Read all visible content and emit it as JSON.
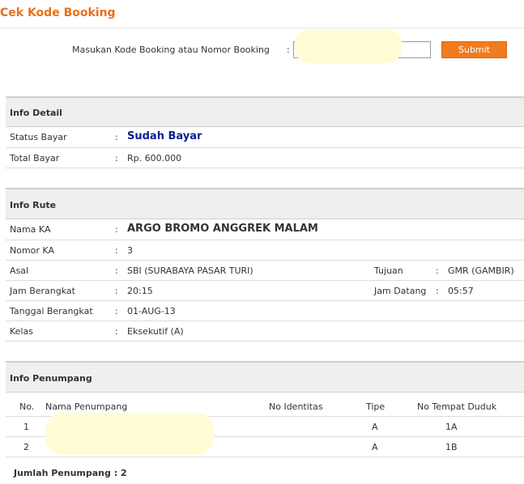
{
  "page": {
    "title": "Cek Kode Booking"
  },
  "search": {
    "label": "Masukan Kode Booking atau Nomor Booking",
    "colon": ":",
    "value": "",
    "submit_label": "Submit"
  },
  "info_detail": {
    "heading": "Info Detail",
    "rows": [
      {
        "label": "Status Bayar",
        "value": "Sudah Bayar"
      },
      {
        "label": "Total Bayar",
        "value": "Rp. 600.000"
      }
    ]
  },
  "info_rute": {
    "heading": "Info Rute",
    "rows": [
      {
        "label": "Nama KA",
        "value": "ARGO BROMO ANGGREK MALAM"
      },
      {
        "label": "Nomor KA",
        "value": "3"
      },
      {
        "label": "Asal",
        "value": "SBI (SURABAYA PASAR TURI)",
        "label2": "Tujuan",
        "value2": "GMR (GAMBIR)"
      },
      {
        "label": "Jam Berangkat",
        "value": "20:15",
        "label2": "Jam Datang",
        "value2": "05:57"
      },
      {
        "label": "Tanggal Berangkat",
        "value": "01-AUG-13"
      },
      {
        "label": "Kelas",
        "value": "Eksekutif (A)"
      }
    ]
  },
  "info_penumpang": {
    "heading": "Info Penumpang",
    "columns": [
      "No.",
      "Nama Penumpang",
      "No Identitas",
      "Tipe",
      "No Tempat Duduk"
    ],
    "rows": [
      {
        "no": "1",
        "nama": "",
        "identitas": "",
        "tipe": "A",
        "kursi": "1A"
      },
      {
        "no": "2",
        "nama": "",
        "identitas": "",
        "tipe": "A",
        "kursi": "1B"
      }
    ],
    "summary": "Jumlah Penumpang : 2"
  },
  "colors": {
    "accent": "#e8701a",
    "button": "#f07c1e",
    "status_paid": "#0a1f8f",
    "section_bg": "#efefef"
  },
  "colon": ":"
}
